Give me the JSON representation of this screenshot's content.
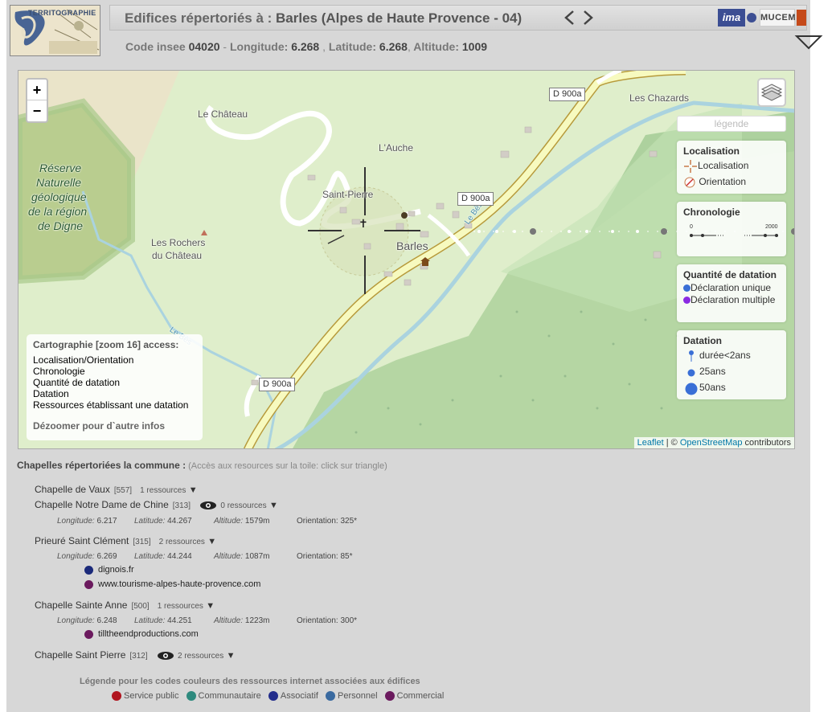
{
  "header": {
    "logo_text": "TERRITOGRAPHIE",
    "title_prefix": "Edifices répertoriés à : ",
    "title_place": "Barles (Alpes de Haute Provence - 04)",
    "logos": {
      "ima": "ima",
      "mucem": "MUCEM"
    },
    "subtitle": {
      "insee_label": "Code insee",
      "insee": "04020",
      "lon_label": "Longitude:",
      "lon": "6.268",
      "lat_label": "Latitude:",
      "lat": "6.268",
      "alt_label": "Altitude:",
      "alt": "1009"
    }
  },
  "map": {
    "zoom_in": "+",
    "zoom_out": "−",
    "labels": {
      "le_chateau": "Le Château",
      "les_chazards": "Les Chazards",
      "l_auche": "L'Auche",
      "saint_pierre": "Saint-Pierre",
      "barles": "Barles",
      "le_bes": "Le Bès",
      "rochers_1": "Les Rochers",
      "rochers_2": "du Château",
      "reserve_1": "Réserve",
      "reserve_2": "Naturelle",
      "reserve_3": "géologique",
      "reserve_4": "de la région",
      "reserve_5": "de Digne",
      "riviere": "Le Bès"
    },
    "roads": [
      "D 900a",
      "D 900a",
      "D 900a"
    ],
    "legend_button": "légende",
    "panels": {
      "localisation": {
        "title": "Localisation",
        "items": [
          "Localisation",
          "Orientation"
        ]
      },
      "chronologie": {
        "title": "Chronologie",
        "start": "0",
        "end": "2000"
      },
      "quantite": {
        "title": "Quantité de datation",
        "items": [
          "Déclaration unique",
          "Déclaration multiple"
        ]
      },
      "datation": {
        "title": "Datation",
        "items": [
          "durée<2ans",
          "25ans",
          "50ans"
        ]
      }
    },
    "info": {
      "title": "Cartographie [zoom 16] access:",
      "lines": [
        "Localisation/Orientation",
        "Chronologie",
        "Quantité de datation",
        "Datation",
        "Ressources établissant une datation"
      ],
      "zoom_out": "Dézoomer pour d`autre infos"
    },
    "attribution": {
      "leaflet": "Leaflet",
      "sep": " | © ",
      "osm": "OpenStreetMap",
      "rest": " contributors"
    }
  },
  "chapels": {
    "heading": "Chapelles répertoriées la commune :",
    "hint": "(Accès aux resources sur la toile: click sur triangle)",
    "items": [
      {
        "name": "Chapelle de Vaux",
        "code": "[557]",
        "resources": "1 ressources",
        "has_eye": false
      },
      {
        "name": "Chapelle Notre Dame de Chine",
        "code": "[313]",
        "resources": "0 ressources",
        "has_eye": true,
        "coords": {
          "lon": "6.217",
          "lat": "44.267",
          "alt": "1579m",
          "orient": "325*"
        }
      },
      {
        "name": "Prieuré Saint Clément",
        "code": "[315]",
        "resources": "2 ressources",
        "has_eye": false,
        "coords": {
          "lon": "6.269",
          "lat": "44.244",
          "alt": "1087m",
          "orient": "85*"
        },
        "links": [
          {
            "url": "dignois.fr",
            "color": "#1b2a7a"
          },
          {
            "url": "www.tourisme-alpes-haute-provence.com",
            "color": "#6b1a5e"
          }
        ]
      },
      {
        "name": "Chapelle Sainte Anne",
        "code": "[500]",
        "resources": "1 ressources",
        "has_eye": false,
        "coords": {
          "lon": "6.248",
          "lat": "44.251",
          "alt": "1223m",
          "orient": "300*"
        },
        "links": [
          {
            "url": "tilltheendproductions.com",
            "color": "#6b1a5e"
          }
        ]
      },
      {
        "name": "Chapelle Saint Pierre",
        "code": "[312]",
        "resources": "2 ressources",
        "has_eye": true
      }
    ],
    "coord_labels": {
      "lon": "Longitude:",
      "lat": "Latitude:",
      "alt": "Altitude:",
      "orient": "Orientation:"
    }
  },
  "color_legend": {
    "title": "Légende pour les codes couleurs des ressources internet associées aux édifices",
    "items": [
      {
        "label": "Service public",
        "color": "#b0141e"
      },
      {
        "label": "Communautaire",
        "color": "#2e8a7e"
      },
      {
        "label": "Associatif",
        "color": "#232d8c"
      },
      {
        "label": "Personnel",
        "color": "#3a6aa0"
      },
      {
        "label": "Commercial",
        "color": "#6b1a5e"
      }
    ]
  }
}
